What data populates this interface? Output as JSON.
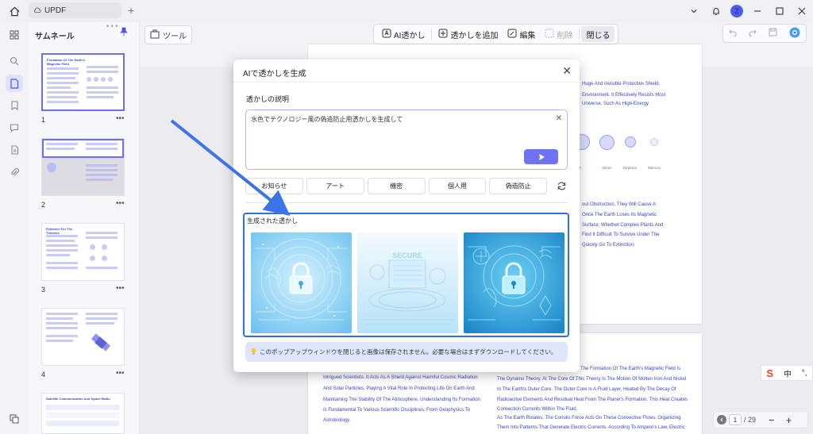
{
  "app": {
    "tab_title": "UPDF"
  },
  "sidebar": {
    "title": "サムネール"
  },
  "thumbs": [
    {
      "num": "1",
      "title": "Formation Of The Earth's Magnetic Field"
    },
    {
      "num": "2",
      "title": ""
    },
    {
      "num": "3",
      "title": "Evidence For The Theories"
    },
    {
      "num": "4",
      "title": ""
    },
    {
      "num": "",
      "title": "Satellite Communication And Space Radio"
    }
  ],
  "toolbar": {
    "tools_label": "ツール",
    "ai_watermark": "AI透かし",
    "add_watermark": "透かしを追加",
    "edit": "編集",
    "delete": "削除",
    "close": "閉じる"
  },
  "modal": {
    "title": "AIで透かしを生成",
    "desc_label": "透かしの説明",
    "prompt_value": "水色でテクノロジー風の偽造防止用透かしを生成して",
    "chips": [
      "お知らせ",
      "アート",
      "機密",
      "個人用",
      "偽造防止"
    ],
    "generated_label": "生成された透かし",
    "notice": "このポップアップウィンドウを閉じると画像は保存されません。必要な場合はまずダウンロードしてください。"
  },
  "page_top_lines": [
    "Huge And Invisible Protective Shield,",
    "Environment. It Effectively Resists Most",
    "Universe, Such As High-Energy"
  ],
  "page_mid_lines": [
    "out Obstruction, They Will Cause A",
    "Once The Earth Loses Its Magnetic",
    "Surface, Whether Complex Plants And",
    "Find It Difficult To Survive Under The",
    "Quickly Go To Extinction."
  ],
  "planet_labels": [
    "Venus",
    "Neptune",
    "Mercury"
  ],
  "page_bottom_left_lines": [
    "Intrigued Scientists. It Acts As A Shield Against Harmful Cosmic Radiation",
    "And Solar Particles, Playing A Vital Role In Protecting Life On Earth And",
    "Maintaining The Stability Of The Atmosphere. Understanding Its Formation",
    "Is Fundamental To Various Scientific Disciplines, From Geophysics To",
    "Astrobiology."
  ],
  "page_bottom_right_lines": [
    "The Formation Of The Earth's Magnetic Field Is",
    "The Dynamo Theory. At The Core Of This Theory Is The Motion Of Molten Iron And Nickel",
    "In The Earth's Outer Core. The Outer Core Is A Fluid Layer, Heated By The Decay Of",
    "Radioactive Elements And Residual Heat From The Planet's Formation. This Heat Creates",
    "Convection Currents Within The Fluid.",
    "As The Earth Rotates, The Coriolis Force Acts On These Convective Flows, Organizing",
    "Them Into Patterns That Generate Electric Currents. According To Ampere's Law, Electric"
  ],
  "pager": {
    "current": "1",
    "total": "/ 29"
  },
  "ime": {
    "lang": "中"
  }
}
